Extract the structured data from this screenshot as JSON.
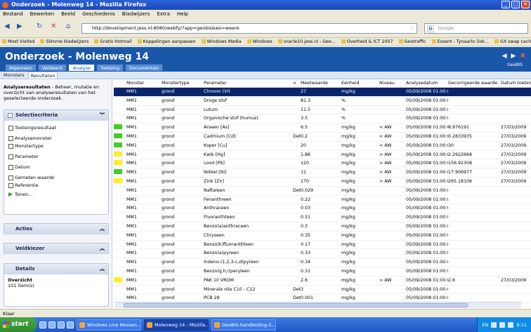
{
  "window": {
    "title": "Onderzoek - Molenweg 14 - Mozilla Firefox"
  },
  "menu": [
    "Bestand",
    "Bewerken",
    "Beeld",
    "Geschiedenis",
    "Bladwijzers",
    "Extra",
    "Help"
  ],
  "navbar": {
    "url": "http://development.jess.nl:8080/webfy/?app=geobis&ws=weere",
    "search_placeholder": "Google"
  },
  "bookmarks": [
    "Most Visited",
    "Slimme bladwijzers",
    "Gratis Hotmail",
    "Koppelingen aanpassen",
    "Windows Media",
    "Windows",
    "oracle10.jess.nl - Geo...",
    "Overheid & ICT 2007",
    "Geotraffic",
    "Essent - Tynaarlo (lok...",
    "GX swap cach"
  ],
  "app": {
    "title": "Onderzoek  -  Molenweg 14",
    "brand": "GeoBIS"
  },
  "app_tabs": [
    "Algemeen",
    "Veldwerk",
    "Analyse",
    "Toetsing",
    "Documenten"
  ],
  "sub_tabs": [
    "Monsters",
    "Resultaten"
  ],
  "sidebar": {
    "intro_bold": "Analyseresultaten",
    "intro_text": " - Beheer, mutatie en overzicht van analyseresultaten van het geselecteerde onderzoek.",
    "selectie_title": "Selectiecriteria",
    "criteria": [
      "Toetsingsresultaat",
      "Analysemonster",
      "Monstertype",
      "Parameter",
      "Datum",
      "Gemeten waarde",
      "Referentie"
    ],
    "tonen": "Tonen...",
    "acties": "Acties",
    "veldkiezer": "Veldkiezer",
    "details": "Details",
    "overzicht": "Overzicht",
    "count": "101 item(s)"
  },
  "table": {
    "headers": [
      "Monster",
      "Monstertype",
      "Parameter",
      "<",
      "Meetwaarde",
      "Eenheid",
      "Niveau",
      "Analysedatum",
      "Gecorrigeerde waarde",
      "Datum toetsing"
    ],
    "rows": [
      {
        "flag": "",
        "monster": "MM1",
        "type": "grond",
        "param": "Chroom (VI)",
        "lt": "",
        "val": "27",
        "unit": "mg/kg",
        "niveau": "",
        "datum": "05/09/2008 01:00:0",
        "corr": "",
        "toets": "",
        "sel": true
      },
      {
        "flag": "",
        "monster": "MM1",
        "type": "grond",
        "param": "Droge stof",
        "lt": "",
        "val": "81.3",
        "unit": "%",
        "niveau": "",
        "datum": "05/09/2008 01:00:0",
        "corr": "",
        "toets": ""
      },
      {
        "flag": "",
        "monster": "MM1",
        "type": "grond",
        "param": "Lutum",
        "lt": "",
        "val": "11.5",
        "unit": "%",
        "niveau": "",
        "datum": "05/09/2008 01:00:0",
        "corr": "",
        "toets": ""
      },
      {
        "flag": "",
        "monster": "MM1",
        "type": "grond",
        "param": "Organische stof (humus)",
        "lt": "",
        "val": "3.5",
        "unit": "%",
        "niveau": "",
        "datum": "05/09/2008 01:00:0",
        "corr": "",
        "toets": ""
      },
      {
        "flag": "green",
        "monster": "MM1",
        "type": "grond",
        "param": "Arseen [As]",
        "lt": "",
        "val": "6.5",
        "unit": "mg/kg",
        "niveau": "< AW",
        "datum": "05/09/2008 01:00:0",
        "corr": "8.976191",
        "toets": "27/03/2009"
      },
      {
        "flag": "green",
        "monster": "MM1",
        "type": "grond",
        "param": "Cadmium [Cd]",
        "lt": "Det",
        "val": "0.2",
        "unit": "mg/kg",
        "niveau": "< AW",
        "datum": "05/09/2008 01:00:0",
        "corr": "0.2833935",
        "toets": "27/03/2009"
      },
      {
        "flag": "green",
        "monster": "MM1",
        "type": "grond",
        "param": "Koper [Cu]",
        "lt": "",
        "val": "20",
        "unit": "mg/kg",
        "niveau": "< AW",
        "datum": "05/09/2008 01:00:0",
        "corr": "30",
        "toets": "27/03/2009"
      },
      {
        "flag": "yellow",
        "monster": "MM1",
        "type": "grond",
        "param": "Kwik [Hg]",
        "lt": "",
        "val": "1.86",
        "unit": "mg/kg",
        "niveau": "> AW",
        "datum": "05/09/2008 01:00:0",
        "corr": "2.2922668",
        "toets": "27/03/2009"
      },
      {
        "flag": "yellow",
        "monster": "MM1",
        "type": "grond",
        "param": "Lood [Pb]",
        "lt": "",
        "val": "120",
        "unit": "mg/kg",
        "niveau": "> AW",
        "datum": "05/09/2008 01:00:0",
        "corr": "156.92308",
        "toets": "27/03/2009"
      },
      {
        "flag": "green",
        "monster": "MM1",
        "type": "grond",
        "param": "Nikkel [Ni]",
        "lt": "",
        "val": "11",
        "unit": "mg/kg",
        "niveau": "< AW",
        "datum": "05/09/2008 01:00:0",
        "corr": "17.906977",
        "toets": "27/03/2009"
      },
      {
        "flag": "yellow",
        "monster": "MM1",
        "type": "grond",
        "param": "Zink [Zn]",
        "lt": "",
        "val": "170",
        "unit": "mg/kg",
        "niveau": "> AW",
        "datum": "05/09/2008 01:00:0",
        "corr": "265.18106",
        "toets": "27/03/2009"
      },
      {
        "flag": "",
        "monster": "MM1",
        "type": "grond",
        "param": "Naftaleen",
        "lt": "Det",
        "val": "0.029",
        "unit": "mg/kg",
        "niveau": "",
        "datum": "05/09/2008 01:00:0",
        "corr": "",
        "toets": ""
      },
      {
        "flag": "",
        "monster": "MM1",
        "type": "grond",
        "param": "Fenanthreen",
        "lt": "",
        "val": "0.22",
        "unit": "mg/kg",
        "niveau": "",
        "datum": "05/09/2008 01:00:0",
        "corr": "",
        "toets": ""
      },
      {
        "flag": "",
        "monster": "MM1",
        "type": "grond",
        "param": "Anthraceen",
        "lt": "",
        "val": "0.03",
        "unit": "mg/kg",
        "niveau": "",
        "datum": "05/09/2008 01:00:0",
        "corr": "",
        "toets": ""
      },
      {
        "flag": "",
        "monster": "MM1",
        "type": "grond",
        "param": "Fluoranthteen",
        "lt": "",
        "val": "0.51",
        "unit": "mg/kg",
        "niveau": "",
        "datum": "05/09/2008 01:00:0",
        "corr": "",
        "toets": ""
      },
      {
        "flag": "",
        "monster": "MM1",
        "type": "grond",
        "param": "Benzo(a)anthraceen",
        "lt": "",
        "val": "0.3",
        "unit": "mg/kg",
        "niveau": "",
        "datum": "05/09/2008 01:00:0",
        "corr": "",
        "toets": ""
      },
      {
        "flag": "",
        "monster": "MM1",
        "type": "grond",
        "param": "Chryseen",
        "lt": "",
        "val": "0.35",
        "unit": "mg/kg",
        "niveau": "",
        "datum": "05/09/2008 01:00:0",
        "corr": "",
        "toets": ""
      },
      {
        "flag": "",
        "monster": "MM1",
        "type": "grond",
        "param": "Benzo(k)fluoranthteen",
        "lt": "",
        "val": "0.17",
        "unit": "mg/kg",
        "niveau": "",
        "datum": "05/09/2008 01:00:0",
        "corr": "",
        "toets": ""
      },
      {
        "flag": "",
        "monster": "MM1",
        "type": "grond",
        "param": "Benzo(a)pyreen",
        "lt": "",
        "val": "0.33",
        "unit": "mg/kg",
        "niveau": "",
        "datum": "05/09/2008 01:00:0",
        "corr": "",
        "toets": ""
      },
      {
        "flag": "",
        "monster": "MM1",
        "type": "grond",
        "param": "Indeno-(1,2,3-c,d)pyreen",
        "lt": "",
        "val": "0.34",
        "unit": "mg/kg",
        "niveau": "",
        "datum": "05/09/2008 01:00:0",
        "corr": "",
        "toets": ""
      },
      {
        "flag": "",
        "monster": "MM1",
        "type": "grond",
        "param": "Benzo(g,h,i)peryleen",
        "lt": "",
        "val": "0.31",
        "unit": "mg/kg",
        "niveau": "",
        "datum": "05/09/2008 01:00:0",
        "corr": "",
        "toets": ""
      },
      {
        "flag": "yellow",
        "monster": "MM1",
        "type": "grond",
        "param": "PAK 10 VROM",
        "lt": "",
        "val": "2.6",
        "unit": "mg/kg",
        "niveau": "> AW",
        "datum": "05/09/2008 01:00:0",
        "corr": "2.6",
        "toets": "27/03/2009"
      },
      {
        "flag": "",
        "monster": "MM1",
        "type": "grond",
        "param": "Minerale olie C10 - C12",
        "lt": "Det",
        "val": "3",
        "unit": "mg/kg",
        "niveau": "",
        "datum": "05/09/2008 01:00:0",
        "corr": "",
        "toets": ""
      },
      {
        "flag": "",
        "monster": "MM1",
        "type": "grond",
        "param": "PCB 28",
        "lt": "Det",
        "val": "0.001",
        "unit": "mg/kg",
        "niveau": "",
        "datum": "05/09/2008 01:00:0",
        "corr": "",
        "toets": ""
      }
    ]
  },
  "colors": {
    "green": "#44cc22",
    "yellow": "#ffee22",
    "selected": "#0a246a",
    "header": "#1a57a8"
  },
  "status": "Klaar",
  "taskbar": {
    "start": "start",
    "tasks": [
      "Windows Live Messen...",
      "Molenweg 14 - Mozilla...",
      "GeoBIS-handleiding-2..."
    ],
    "lang": "EN",
    "time": "9:11"
  }
}
